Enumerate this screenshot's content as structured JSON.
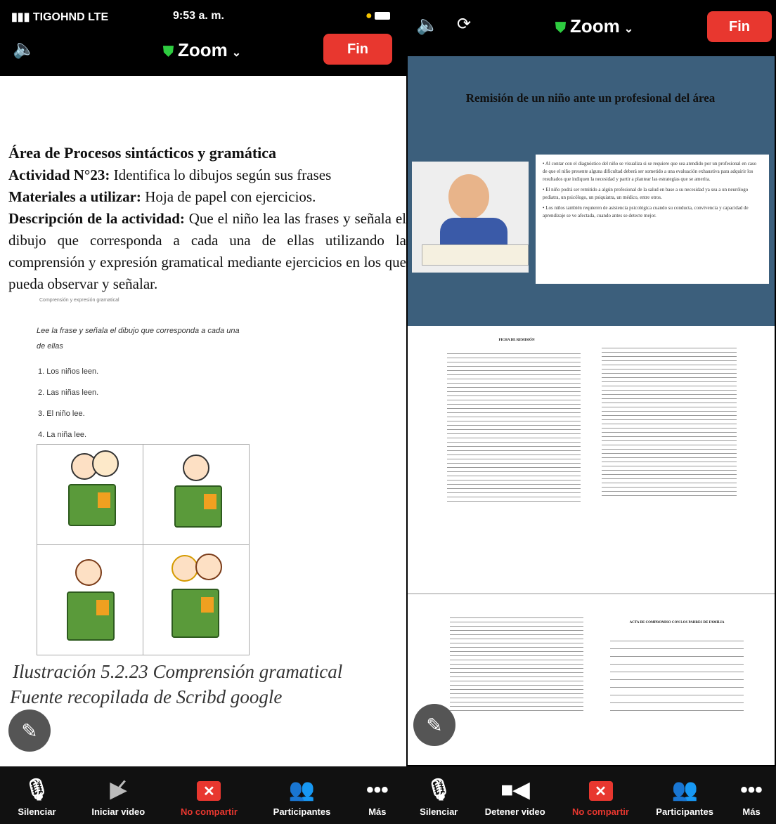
{
  "left": {
    "status": {
      "carrier": "TIGOHND  LTE",
      "time": "9:53 a. m."
    },
    "header": {
      "title": "Zoom",
      "end_label": "Fin"
    },
    "doc": {
      "heading": "Área de Procesos sintácticos y gramática",
      "activity_label": "Actividad N°23:",
      "activity_text": " Identifica lo dibujos según sus frases",
      "materials_label": "Materiales a utilizar:",
      "materials_text": " Hoja de papel con ejercicios.",
      "description_label": "Descripción de la actividad:",
      "description_text": " Que el niño lea las frases y señala el dibujo que corresponda a cada una de ellas utilizando la comprensión y expresión gramatical mediante ejercicios en los que pueda observar y señalar.",
      "small_caption": "Comprensión y expresión gramatical",
      "instruction": "Lee la frase y señala el dibujo que corresponda a cada una de ellas",
      "sentences": [
        "1. Los niños leen.",
        "2. Las niñas leen.",
        "3. El niño lee.",
        "4. La niña lee."
      ],
      "figure_caption": "Ilustración 5.2.23 Comprensión gramatical",
      "figure_source": "Fuente recopilada de Scribd google"
    },
    "toolbar": [
      {
        "icon": "microphone-icon",
        "label": "Silenciar"
      },
      {
        "icon": "video-off-icon",
        "label": "Iniciar video"
      },
      {
        "icon": "stop-share-icon",
        "label": "No compartir"
      },
      {
        "icon": "participants-icon",
        "label": "Participantes"
      },
      {
        "icon": "more-icon",
        "label": "Más"
      }
    ]
  },
  "right": {
    "header": {
      "title": "Zoom",
      "end_label": "Fin"
    },
    "slide": {
      "title": "Remisión de un niño ante un profesional del área",
      "bullets": [
        "Al contar con el diagnóstico del niño se visualiza si se requiere que sea atendido por un profesional en caso de que el niño presente alguna dificultad deberá ser sometido a una evaluación exhaustiva para adquirir los resultados que indiquen la necesidad y partir a plantear las estrategias que se amerita.",
        "El niño podrá ser remitido a algún profesional de la salud en base a su necesidad ya sea a un neurólogo pediatra, un psicólogo, un psiquiatra, un médico, entre otros.",
        "Los niños también requieren de asistencia psicológica cuando su conducta, convivencia y capacidad de aprendizaje se ve afectada, cuando antes se detecte mejor."
      ]
    },
    "form1": {
      "title": "FICHA DE REMISIÓN"
    },
    "form2": {
      "title": "ACTA DE COMPROMISO CON LOS PADRES DE FAMILIA"
    },
    "toolbar": [
      {
        "icon": "microphone-icon",
        "label": "Silenciar"
      },
      {
        "icon": "video-icon",
        "label": "Detener video"
      },
      {
        "icon": "stop-share-icon",
        "label": "No compartir"
      },
      {
        "icon": "participants-icon",
        "label": "Participantes"
      },
      {
        "icon": "more-icon",
        "label": "Más"
      }
    ]
  },
  "colors": {
    "accent_red": "#e8372f",
    "shield_green": "#2ecc40",
    "slide_blue": "#3c5f7c"
  }
}
